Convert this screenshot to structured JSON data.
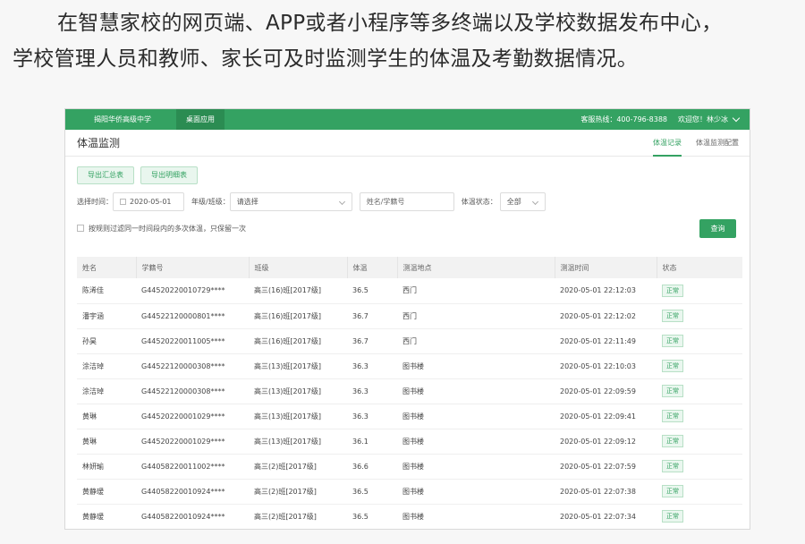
{
  "intro": {
    "line1": "在智慧家校的网页端、APP或者小程序等多终端以及学校数据发布中心，",
    "line2": "学校管理人员和教师、家长可及时监测学生的体温及考勤数据情况。"
  },
  "topbar": {
    "school": "揭阳华侨高级中学",
    "desktop_app": "桌面应用",
    "hotline": "客服热线：400-796-8388",
    "welcome": "欢迎您！林少冰"
  },
  "page": {
    "title": "体温监测",
    "tabs": [
      "体温记录",
      "体温监测配置"
    ]
  },
  "actions": {
    "export_summary": "导出汇总表",
    "export_detail": "导出明细表"
  },
  "filters": {
    "time_label": "选择时间：",
    "date": "2020-05-01",
    "grade_label": "年级/班级：",
    "grade_value": "请选择",
    "name_placeholder": "姓名/学籍号",
    "status_label": "体温状态：",
    "status_value": "全部",
    "dedupe_label": "按规则过滤同一时间段内的多次体温，只保留一次",
    "query": "查询"
  },
  "table": {
    "headers": [
      "姓名",
      "学籍号",
      "班级",
      "体温",
      "测温地点",
      "测温时间",
      "状态"
    ],
    "rows": [
      [
        "陈浠佳",
        "G44520220010729****",
        "高三(16)班[2017级]",
        "36.5",
        "西门",
        "2020-05-01 22:12:03",
        "正常"
      ],
      [
        "潘宇涵",
        "G44522120000801****",
        "高三(16)班[2017级]",
        "36.7",
        "西门",
        "2020-05-01 22:12:02",
        "正常"
      ],
      [
        "孙昊",
        "G44520220011005****",
        "高三(16)班[2017级]",
        "36.7",
        "西门",
        "2020-05-01 22:11:49",
        "正常"
      ],
      [
        "涂洁琸",
        "G44522120000308****",
        "高三(13)班[2017级]",
        "36.3",
        "图书楼",
        "2020-05-01 22:10:03",
        "正常"
      ],
      [
        "涂洁琸",
        "G44522120000308****",
        "高三(13)班[2017级]",
        "36.3",
        "图书楼",
        "2020-05-01 22:09:59",
        "正常"
      ],
      [
        "黄琳",
        "G44520220001029****",
        "高三(13)班[2017级]",
        "36.3",
        "图书楼",
        "2020-05-01 22:09:41",
        "正常"
      ],
      [
        "黄琳",
        "G44520220001029****",
        "高三(13)班[2017级]",
        "36.1",
        "图书楼",
        "2020-05-01 22:09:12",
        "正常"
      ],
      [
        "林妍瑜",
        "G44058220011002****",
        "高三(2)班[2017级]",
        "36.6",
        "图书楼",
        "2020-05-01 22:07:59",
        "正常"
      ],
      [
        "黄静瑷",
        "G44058220010924****",
        "高三(2)班[2017级]",
        "36.5",
        "图书楼",
        "2020-05-01 22:07:38",
        "正常"
      ],
      [
        "黄静瑷",
        "G44058220010924****",
        "高三(2)班[2017级]",
        "36.5",
        "图书楼",
        "2020-05-01 22:07:34",
        "正常"
      ]
    ]
  },
  "colors": {
    "primary": "#34a262",
    "primary_dark": "#2b8c52"
  }
}
